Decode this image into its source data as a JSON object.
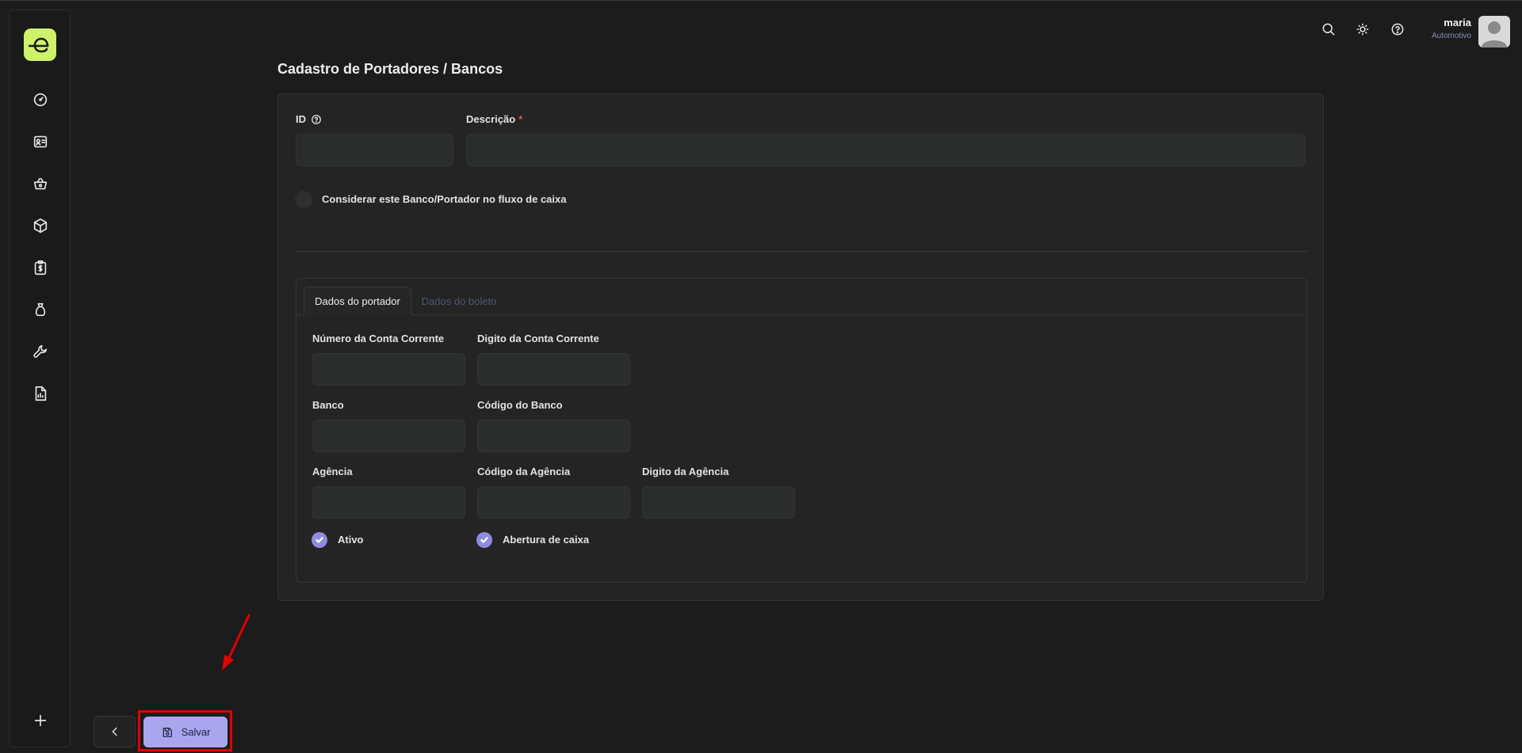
{
  "sidebar": {
    "logo_icon": "e-logo-icon",
    "items": [
      {
        "icon": "dashboard-gauge-icon"
      },
      {
        "icon": "contact-card-icon"
      },
      {
        "icon": "shopping-basket-icon"
      },
      {
        "icon": "box-icon"
      },
      {
        "icon": "billing-clipboard-icon"
      },
      {
        "icon": "money-bag-icon"
      },
      {
        "icon": "wrench-icon"
      },
      {
        "icon": "report-document-icon"
      }
    ],
    "add_icon": "plus-icon"
  },
  "topbar": {
    "icons": [
      "search-icon",
      "theme-sun-icon",
      "help-icon"
    ],
    "user": {
      "name": "maria",
      "company": "Automotivo"
    }
  },
  "page": {
    "title": "Cadastro de Portadores / Bancos"
  },
  "form": {
    "id_label": "ID",
    "id_value": "",
    "descricao_label": "Descrição",
    "descricao_required": "*",
    "descricao_value": "",
    "fluxo_toggle_label": "Considerar este Banco/Portador no fluxo de caixa",
    "fluxo_toggle_on": false
  },
  "tabs": [
    {
      "label": "Dados do portador",
      "active": true
    },
    {
      "label": "Dados do boleto",
      "active": false
    }
  ],
  "portador": {
    "numero_conta_label": "Número da Conta Corrente",
    "digito_conta_label": "Digito da Conta Corrente",
    "banco_label": "Banco",
    "codigo_banco_label": "Código do Banco",
    "agencia_label": "Agência",
    "codigo_agencia_label": "Código da Agência",
    "digito_agencia_label": "Digito da Agência",
    "ativo_label": "Ativo",
    "ativo_checked": true,
    "abertura_label": "Abertura de caixa",
    "abertura_checked": true
  },
  "footer": {
    "save_label": "Salvar"
  },
  "colors": {
    "accent_logo": "#cff26b",
    "save_button": "#a9a6ee",
    "checkbox": "#8f8ce0",
    "annotation_red": "#e00000"
  }
}
